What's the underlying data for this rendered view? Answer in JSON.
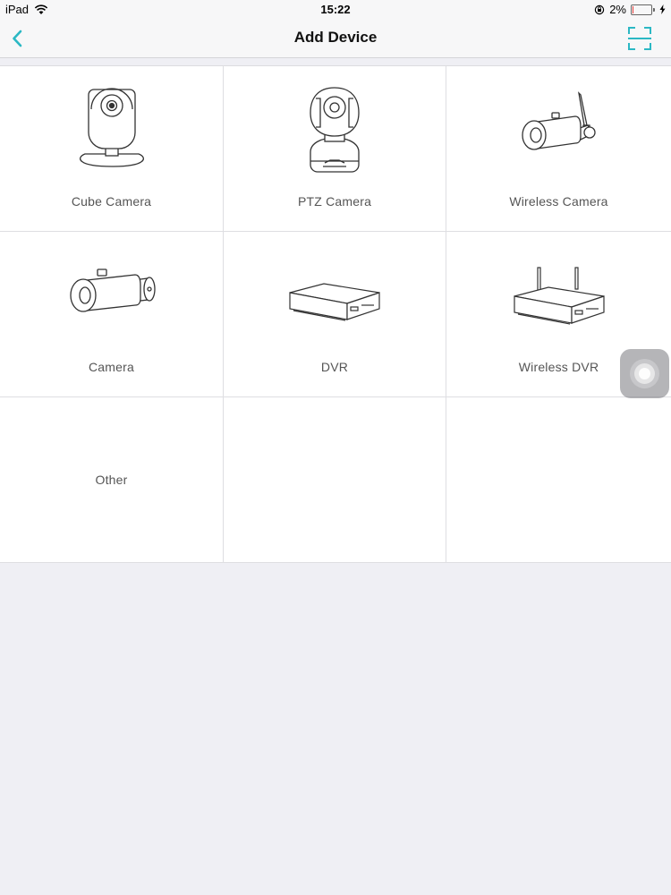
{
  "status_bar": {
    "device": "iPad",
    "time": "15:22",
    "battery": "2%",
    "battery_level": 0.02,
    "icons": [
      "wifi-icon",
      "orientation-lock-icon",
      "battery-icon",
      "charging-icon"
    ]
  },
  "nav": {
    "title": "Add Device",
    "back_icon": "chevron-left-icon",
    "scan_icon": "scan-qr-icon",
    "accent_color": "#2bb8c4"
  },
  "devices": [
    {
      "label": "Cube Camera",
      "icon": "cube-camera-icon"
    },
    {
      "label": "PTZ Camera",
      "icon": "ptz-camera-icon"
    },
    {
      "label": "Wireless Camera",
      "icon": "wireless-camera-icon"
    },
    {
      "label": "Camera",
      "icon": "bullet-camera-icon"
    },
    {
      "label": "DVR",
      "icon": "dvr-icon"
    },
    {
      "label": "Wireless DVR",
      "icon": "wireless-dvr-icon"
    },
    {
      "label": "Other",
      "icon": ""
    }
  ]
}
